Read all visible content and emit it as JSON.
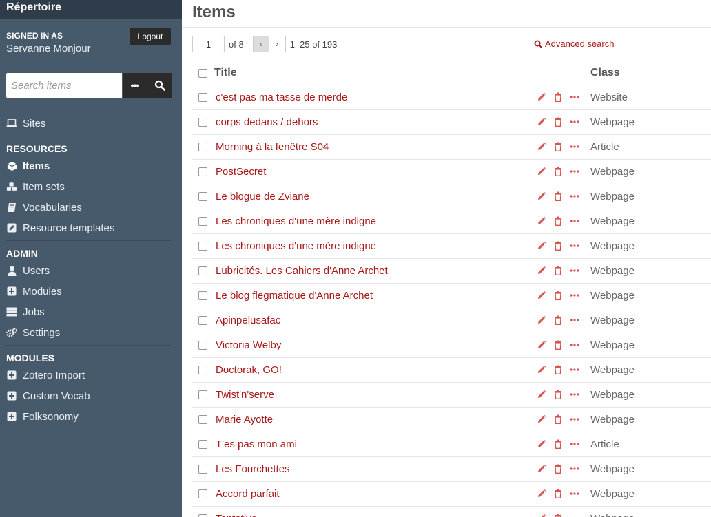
{
  "sidebar": {
    "site_title": "Répertoire",
    "signed_in_label": "SIGNED IN AS",
    "user_name": "Servanne Monjour",
    "logout_label": "Logout",
    "search_placeholder": "Search items",
    "search_options_label": "•••",
    "sites_label": "Sites",
    "resources_heading": "RESOURCES",
    "resources": [
      "Items",
      "Item sets",
      "Vocabularies",
      "Resource templates"
    ],
    "admin_heading": "ADMIN",
    "admin": [
      "Users",
      "Modules",
      "Jobs",
      "Settings"
    ],
    "modules_heading": "MODULES",
    "modules": [
      "Zotero Import",
      "Custom Vocab",
      "Folksonomy"
    ]
  },
  "main": {
    "title": "Items",
    "pagination": {
      "current_page": "1",
      "of_text": "of 8",
      "range_text": "1–25 of 193",
      "prev_label": "‹",
      "next_label": "›"
    },
    "advanced_search_label": "Advanced search",
    "columns": {
      "title": "Title",
      "class": "Class"
    },
    "rows": [
      {
        "title": "c'est pas ma tasse de merde",
        "class": "Website"
      },
      {
        "title": "corps dedans / dehors",
        "class": "Webpage"
      },
      {
        "title": "Morning à la fenêtre S04",
        "class": "Article"
      },
      {
        "title": "PostSecret",
        "class": "Webpage"
      },
      {
        "title": "Le blogue de Zviane",
        "class": "Webpage"
      },
      {
        "title": "Les chroniques d'une mère indigne",
        "class": "Webpage"
      },
      {
        "title": "Les chroniques d'une mère indigne",
        "class": "Webpage"
      },
      {
        "title": "Lubricités. Les Cahiers d'Anne Archet",
        "class": "Webpage"
      },
      {
        "title": "Le blog flegmatique d'Anne Archet",
        "class": "Webpage"
      },
      {
        "title": "Apinpelusafac",
        "class": "Webpage"
      },
      {
        "title": "Victoria Welby",
        "class": "Webpage"
      },
      {
        "title": "Doctorak, GO!",
        "class": "Webpage"
      },
      {
        "title": "Twist'n'serve",
        "class": "Webpage"
      },
      {
        "title": "Marie Ayotte",
        "class": "Webpage"
      },
      {
        "title": "T'es pas mon ami",
        "class": "Article"
      },
      {
        "title": "Les Fourchettes",
        "class": "Webpage"
      },
      {
        "title": "Accord parfait",
        "class": "Webpage"
      },
      {
        "title": "Tentative",
        "class": "Webpage"
      }
    ]
  },
  "colors": {
    "sidebar_bg": "#475a6c",
    "sidebar_top": "#2f3d4b",
    "link_red": "#a91919",
    "action_red": "#d9534f"
  }
}
